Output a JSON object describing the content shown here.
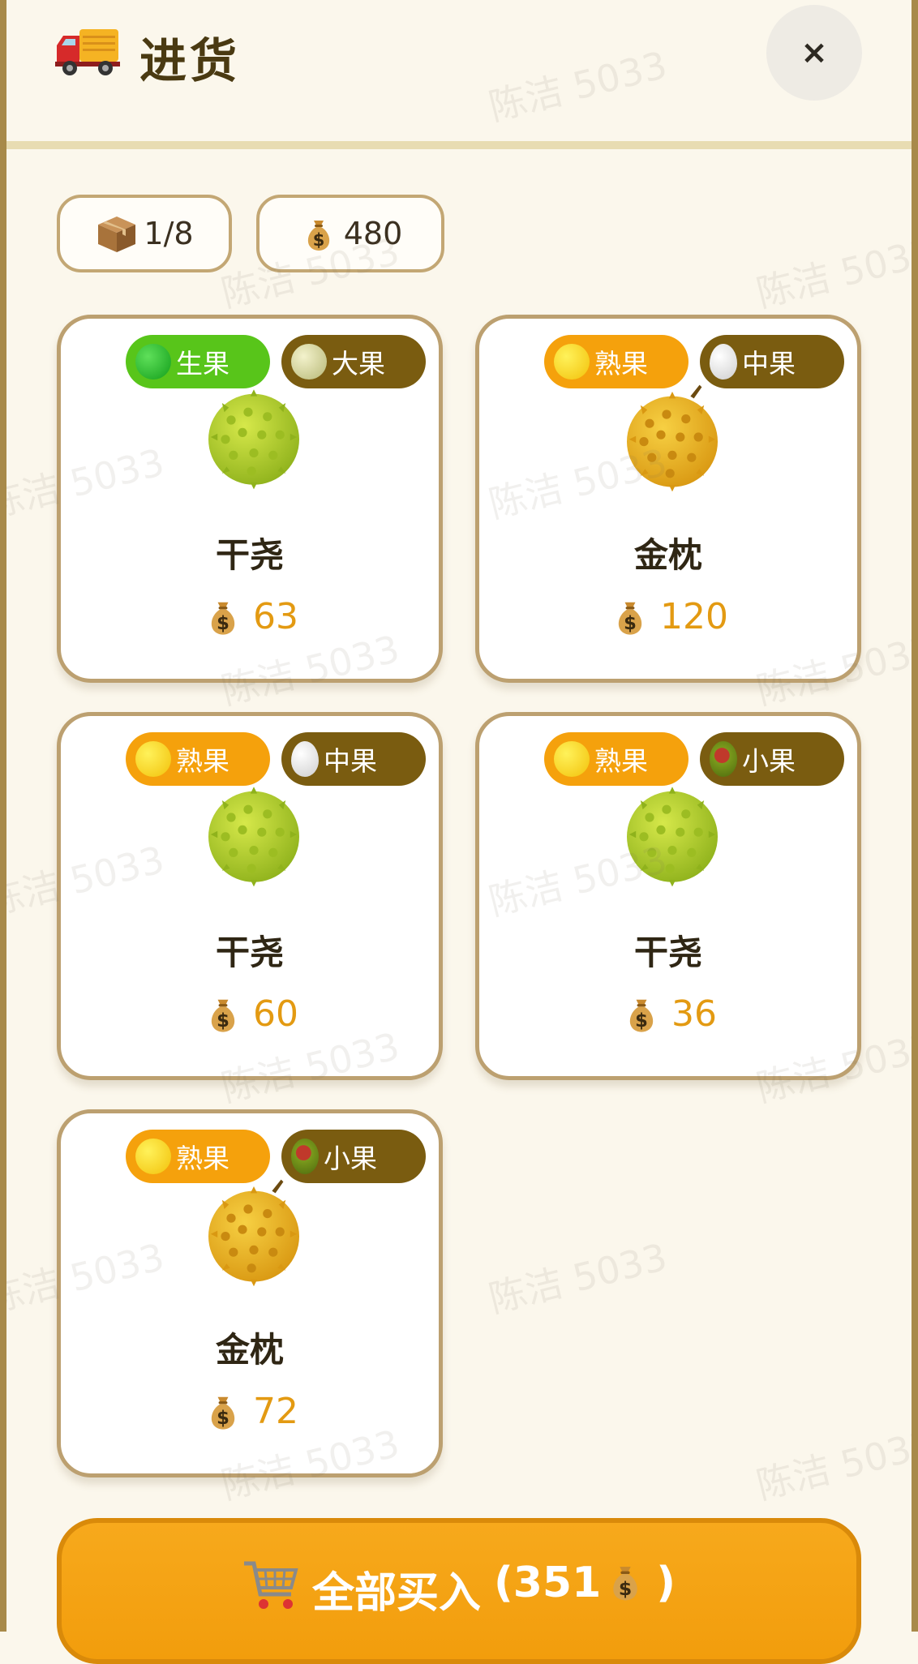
{
  "header": {
    "title": "进货",
    "truck_icon": "delivery-truck-icon",
    "close_label": "×"
  },
  "stats": {
    "slots": "1/8",
    "money": "480",
    "box_icon": "package-icon",
    "money_icon": "money-bag-icon"
  },
  "colors": {
    "raw": "#58c51a",
    "ripe": "#f5a10c",
    "size_tag": "#7a5c10",
    "price": "#e39a12"
  },
  "items": [
    {
      "ripeness": "生果",
      "size": "大果",
      "name": "干尧",
      "price": "63"
    },
    {
      "ripeness": "熟果",
      "size": "中果",
      "name": "金枕",
      "price": "120"
    },
    {
      "ripeness": "熟果",
      "size": "中果",
      "name": "干尧",
      "price": "60"
    },
    {
      "ripeness": "熟果",
      "size": "小果",
      "name": "干尧",
      "price": "36"
    },
    {
      "ripeness": "熟果",
      "size": "小果",
      "name": "金枕",
      "price": "72"
    }
  ],
  "buy_all": {
    "label": "全部买入",
    "total": "(351",
    "close_paren": ")"
  },
  "watermark": "陈洁 5033"
}
